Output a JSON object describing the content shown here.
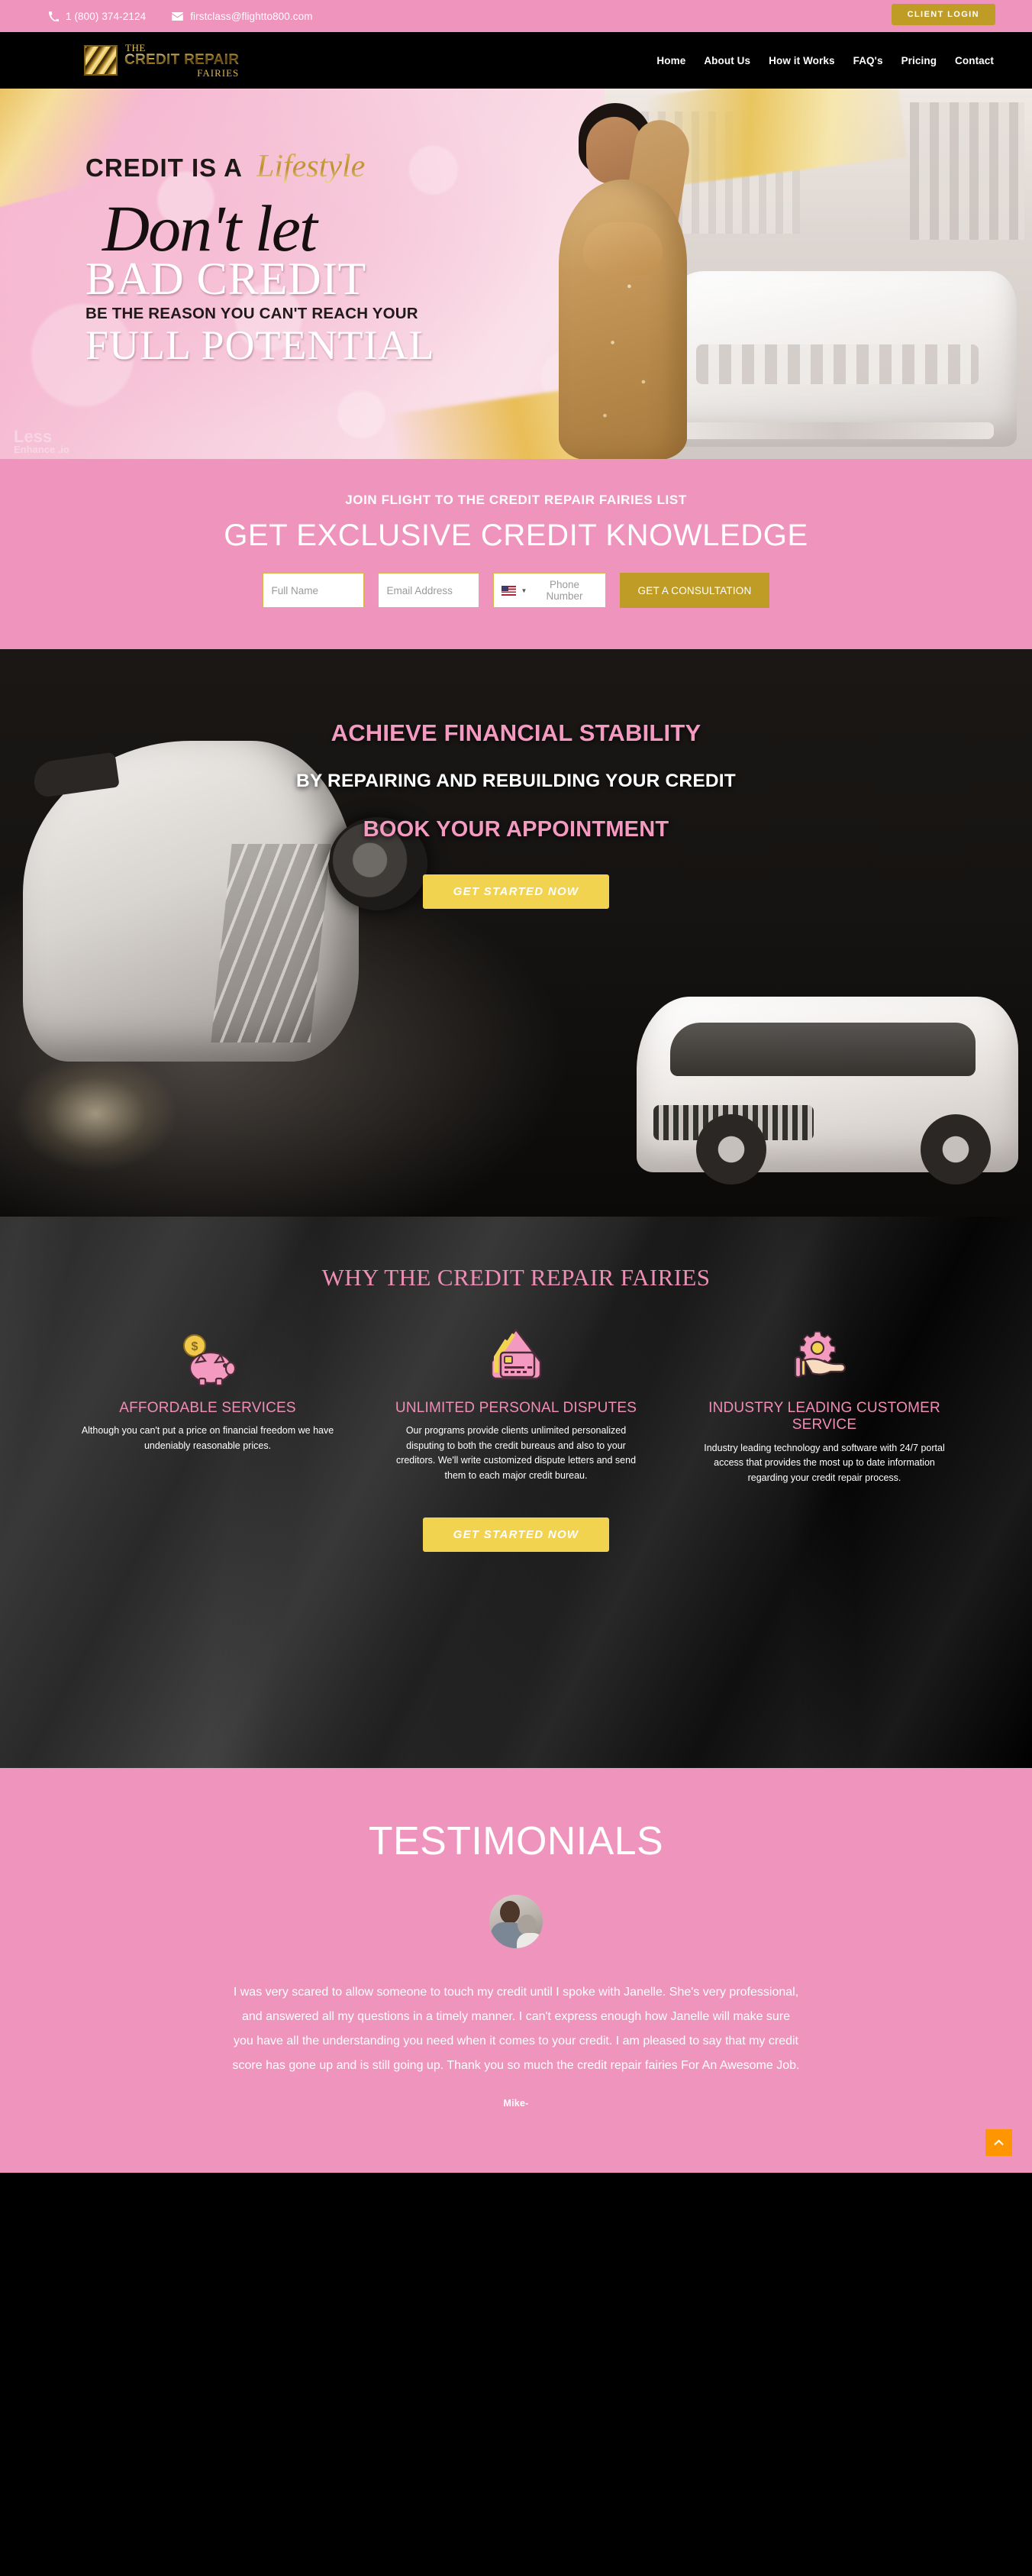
{
  "topbar": {
    "phone": "1 (800) 374-2124",
    "email": "firstclass@flightto800.com",
    "client_login": "CLIENT LOGIN",
    "phone_icon": "phone-icon",
    "email_icon": "envelope-icon"
  },
  "brand": {
    "the": "THE",
    "name": "CREDIT REPAIR",
    "sub": "FAIRIES"
  },
  "nav": {
    "items": [
      {
        "label": "Home"
      },
      {
        "label": "About Us"
      },
      {
        "label": "How it Works"
      },
      {
        "label": "FAQ's"
      },
      {
        "label": "Pricing"
      },
      {
        "label": "Contact"
      }
    ]
  },
  "hero": {
    "line1_plain": "CREDIT IS A",
    "line1_script": "Lifestyle",
    "line2_script": "Don't let",
    "line3": "BAD CREDIT",
    "line4": "BE THE REASON YOU CAN'T REACH YOUR",
    "line5": "FULL POTENTIAL",
    "watermark": "Less",
    "watermark_sub": "Enhance .io"
  },
  "newsletter": {
    "kicker": "JOIN FLIGHT TO THE CREDIT REPAIR FAIRIES LIST",
    "title": "GET EXCLUSIVE CREDIT KNOWLEDGE",
    "name_placeholder": "Full Name",
    "email_placeholder": "Email Address",
    "phone_placeholder": "Phone Number",
    "country_flag": "us-flag-icon",
    "submit": "GET A CONSULTATION"
  },
  "stability": {
    "heading1": "ACHIEVE FINANCIAL STABILITY",
    "heading2": "BY REPAIRING AND REBUILDING YOUR CREDIT",
    "heading3": "BOOK YOUR APPOINTMENT",
    "cta": "GET STARTED NOW"
  },
  "why": {
    "title": "WHY THE CREDIT REPAIR FAIRIES",
    "cta": "GET STARTED NOW",
    "cards": [
      {
        "icon": "piggy-bank-icon",
        "title": "AFFORDABLE SERVICES",
        "body": "Although you can't put a price on financial freedom we have undeniably reasonable prices."
      },
      {
        "icon": "credit-cards-icon",
        "title": "UNLIMITED PERSONAL DISPUTES",
        "body": "Our programs provide clients unlimited personalized disputing to both the credit bureaus and also to your creditors. We'll write customized dispute letters and send them to each major credit bureau."
      },
      {
        "icon": "hand-gear-icon",
        "title": "INDUSTRY LEADING CUSTOMER SERVICE",
        "body": "Industry leading technology and software with 24/7 portal access that provides the most up to date information regarding your credit repair process."
      }
    ]
  },
  "testimonials": {
    "title": "TESTIMONIALS",
    "avatar": "customer-avatar",
    "quote": "I was very scared to allow someone to touch my credit until I spoke with Janelle. She's very professional, and answered all my questions in a timely manner. I can't express enough how Janelle will make sure you have all the understanding you need when it comes to your credit. I am pleased to say that my credit score has gone up and is still going up. Thank you so much the credit repair fairies For An Awesome Job.",
    "author": "Mike-"
  },
  "scroll_top": {
    "icon": "chevron-up-icon"
  },
  "colors": {
    "pink": "#ef94bd",
    "gold": "#bf9c26",
    "yellow": "#f2d34f",
    "accent_pink_text": "#ef8db5",
    "orange": "#ff9500"
  }
}
